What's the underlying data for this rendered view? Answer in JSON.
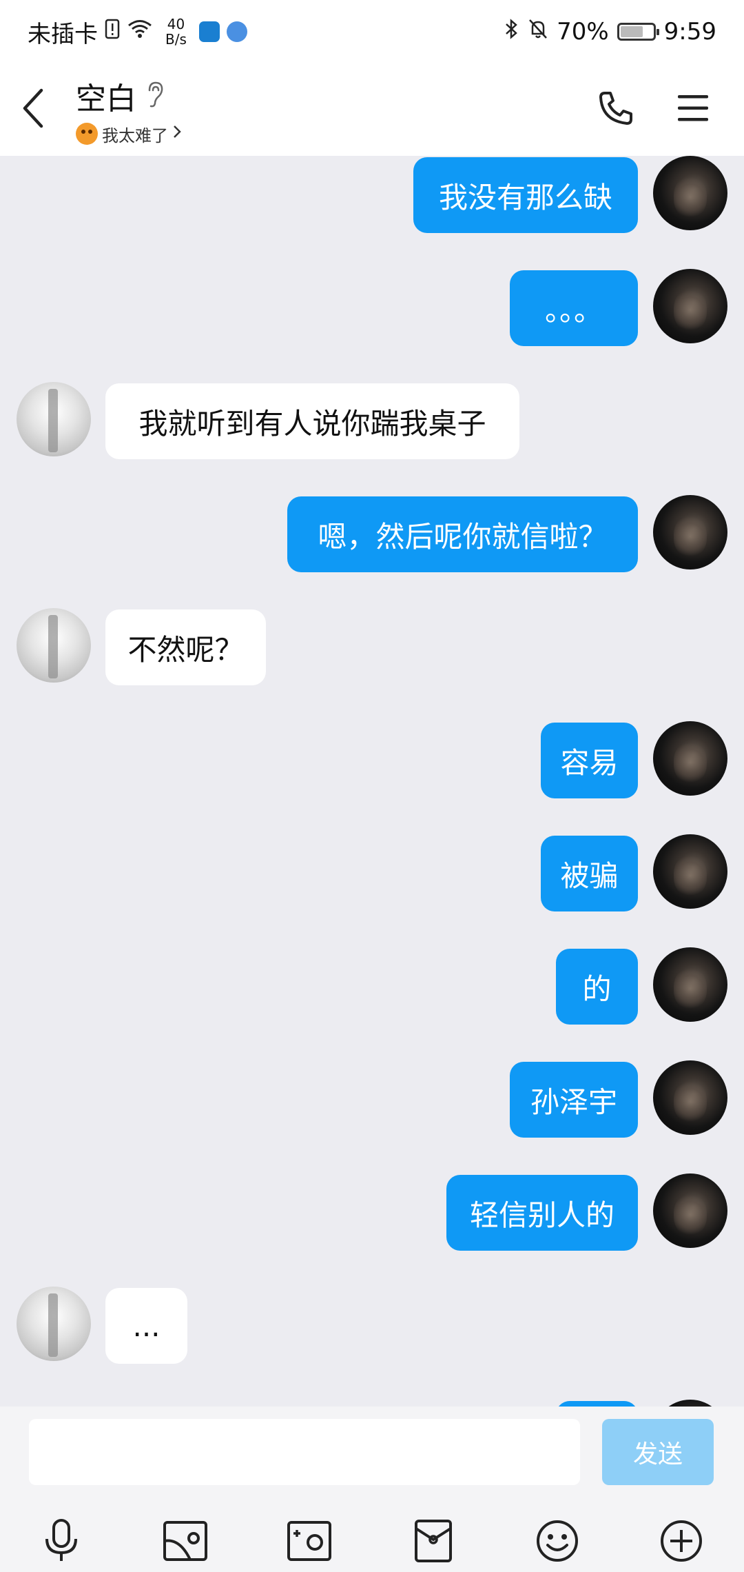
{
  "status_bar": {
    "carrier": "未插卡",
    "speed_value": "40",
    "speed_unit": "B/s",
    "battery": "70%",
    "time": "9:59",
    "battery_level": 0.7
  },
  "header": {
    "title": "空白",
    "subtitle": "我太难了",
    "back_icon": "back-icon",
    "ear_icon": "ear-icon",
    "call_icon": "phone-icon",
    "menu_icon": "menu-icon"
  },
  "messages": [
    {
      "sender": "me",
      "text": "我没有那么缺"
    },
    {
      "sender": "me",
      "text": "。。。"
    },
    {
      "sender": "other",
      "text": "我就听到有人说你踹我桌子"
    },
    {
      "sender": "me",
      "text": "嗯，然后呢你就信啦？"
    },
    {
      "sender": "other",
      "text": "不然呢？"
    },
    {
      "sender": "me",
      "text": "容易"
    },
    {
      "sender": "me",
      "text": "被骗"
    },
    {
      "sender": "me",
      "text": "的"
    },
    {
      "sender": "me",
      "text": "孙泽宇"
    },
    {
      "sender": "me",
      "text": "轻信别人的"
    },
    {
      "sender": "other",
      "text": "..."
    }
  ],
  "input": {
    "value": "",
    "send_label": "发送"
  },
  "toolbar": [
    {
      "name": "microphone-icon"
    },
    {
      "name": "picture-icon"
    },
    {
      "name": "camera-icon"
    },
    {
      "name": "red-packet-icon"
    },
    {
      "name": "emoji-icon"
    },
    {
      "name": "plus-icon"
    }
  ],
  "colors": {
    "my_bubble": "#0f99f5",
    "their_bubble": "#ffffff",
    "background": "#ececf1",
    "send_button": "#8ecff7"
  }
}
